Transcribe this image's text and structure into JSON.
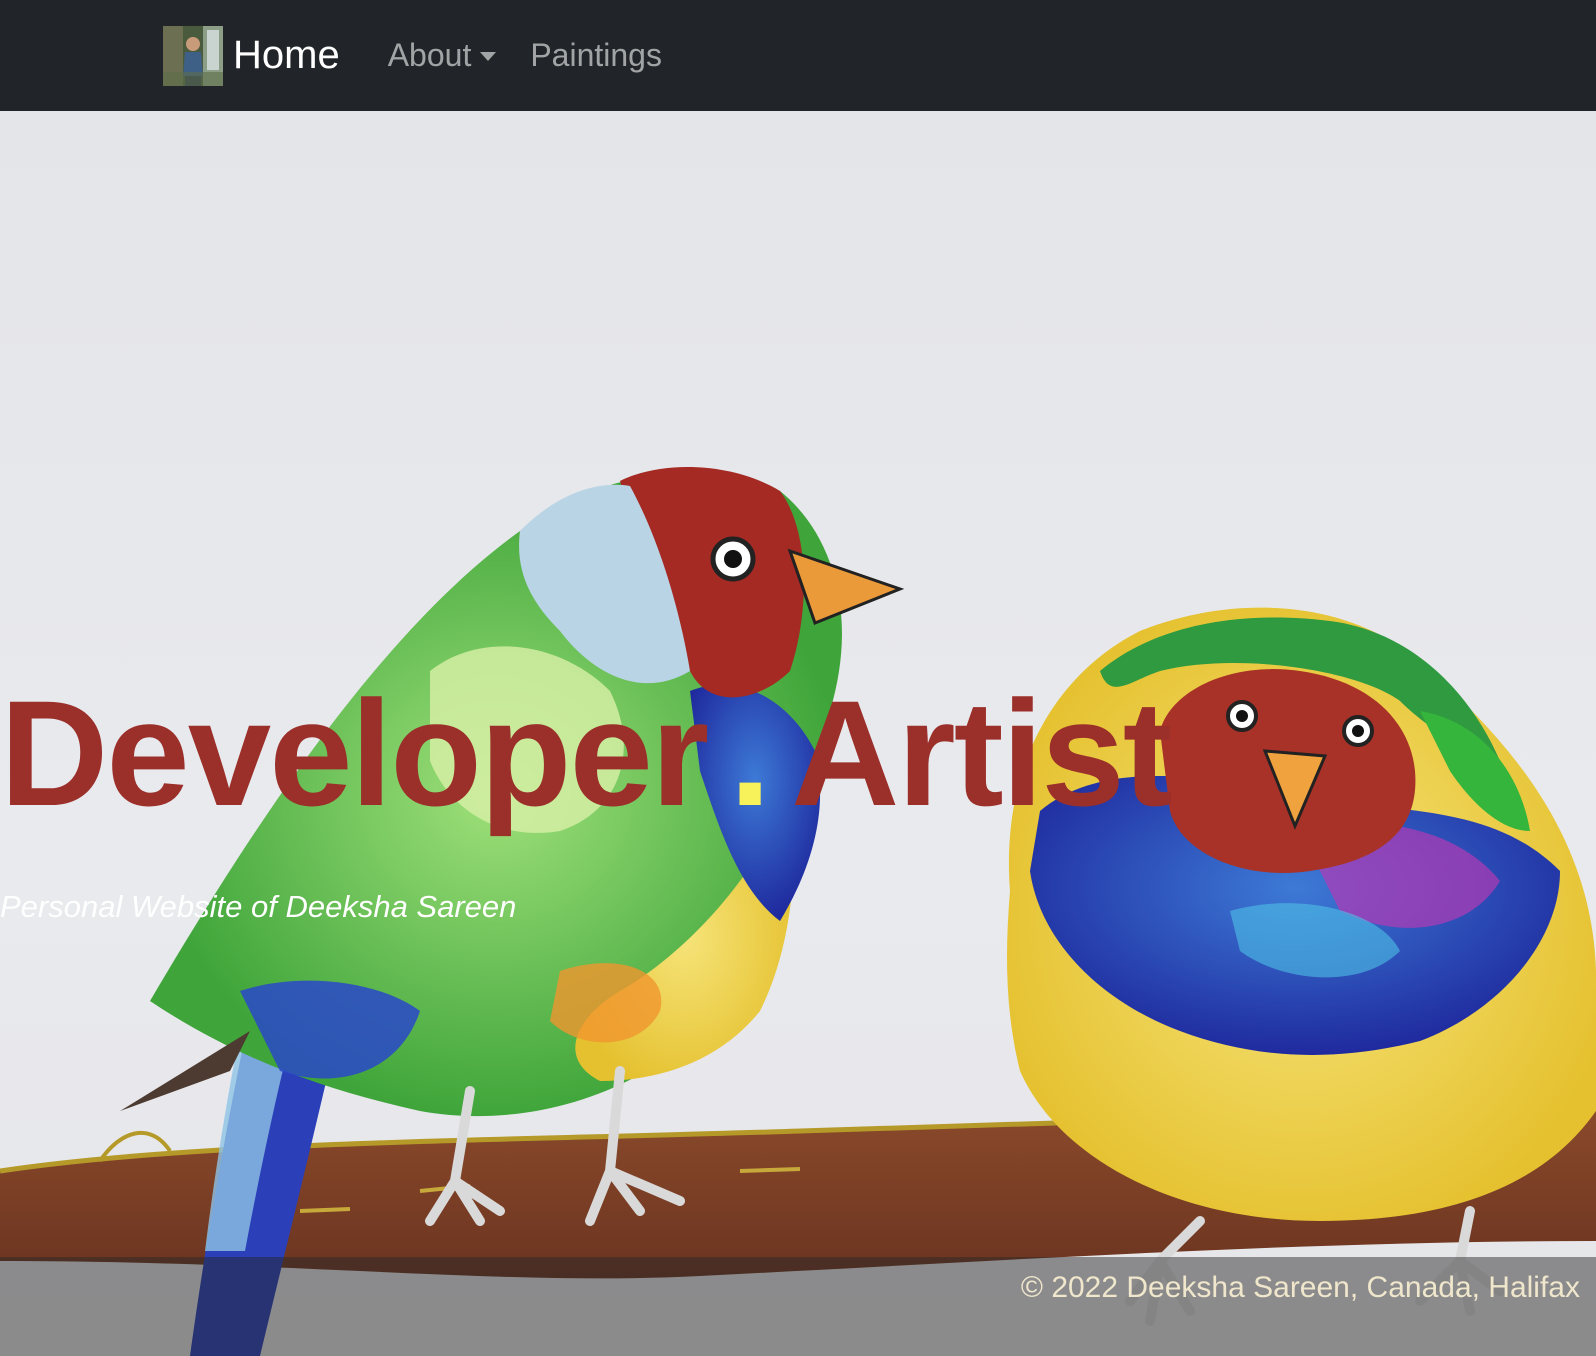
{
  "navbar": {
    "brand_label": "Home",
    "brand_logo": "avatar-photo",
    "links": [
      {
        "label": "About",
        "has_dropdown": true
      },
      {
        "label": "Paintings",
        "has_dropdown": false
      }
    ]
  },
  "hero": {
    "title_part1": "Developer",
    "title_separator": ".",
    "title_part2": "Artist",
    "subtitle": "Personal Website of Deeksha Sareen",
    "background": "watercolor painting of two finches on a branch"
  },
  "footer": {
    "text": "© 2022 Deeksha Sareen, Canada, Halifax"
  },
  "colors": {
    "navbar_bg": "#212529",
    "title": "#9b2f2a",
    "title_dot": "#f7f25a",
    "subtitle": "#ffffff"
  }
}
